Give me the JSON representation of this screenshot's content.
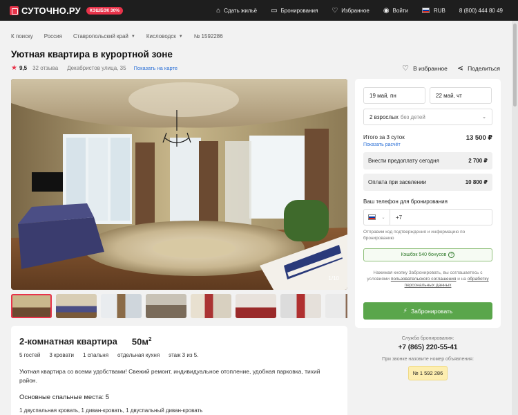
{
  "header": {
    "logo": "СУТОЧНО.РУ",
    "cashback_pill": "КЭШБЭК 30%",
    "nav": [
      {
        "label": "Сдать жильё",
        "icon": "house-plus-icon"
      },
      {
        "label": "Бронирования",
        "icon": "ticket-icon"
      },
      {
        "label": "Избранное",
        "icon": "heart-icon"
      },
      {
        "label": "Войти",
        "icon": "user-icon"
      }
    ],
    "currency": "RUB",
    "phone": "8 (800) 444 80 49"
  },
  "breadcrumb": {
    "back": "К поиску",
    "country": "Россия",
    "region": "Ставропольский край",
    "city": "Кисловодск",
    "listing_id": "№ 1592286"
  },
  "listing": {
    "title": "Уютная квартира в курортной зоне",
    "rating": "9,5",
    "reviews": "32 отзыва",
    "address": "Декабристов улица, 35",
    "map_link": "Показать на карте",
    "favorite": "В избранное",
    "share": "Поделиться",
    "photo_counter": "1/10"
  },
  "description": {
    "rooms": "2-комнатная квартира",
    "area": "50м",
    "area_sup": "2",
    "specs": [
      "5 гостей",
      "3 кровати",
      "1 спальня",
      "отдельная кухня",
      "этаж 3 из 5."
    ],
    "text": "Уютная квартира со всеми удобствами! Свежий ремонт, индивидуальное отопление, удобная парковка, тихий район.",
    "beds_title": "Основные спальные места: 5",
    "beds_list": "1 двуспальная кровать, 1 диван-кровать, 1 двуспальный диван-кровать"
  },
  "booking": {
    "checkin": "19 май, пн",
    "checkout": "22 май, чт",
    "guests": "2 взрослых",
    "guests_muted": "без детей",
    "total_label": "Итого за 3 суток",
    "total": "13 500 ₽",
    "calc_link": "Показать расчёт",
    "prepay_label": "Внести предоплату сегодня",
    "prepay": "2 700 ₽",
    "onsite_label": "Оплата при заселении",
    "onsite": "10 800 ₽",
    "phone_label": "Ваш телефон для бронирования",
    "phone_prefix": "+7",
    "sms_note": "Отправим код подтверждения и информацию по бронированию",
    "cashback": "Кэшбэк 540 бонусов",
    "consent_1": "Нажимая кнопку Забронировать, вы соглашаетесь с условиями ",
    "consent_link1": "пользовательского соглашения",
    "consent_2": " и на ",
    "consent_link2": "обработку персональных данных",
    "button": "Забронировать"
  },
  "service": {
    "label": "Служба бронирования:",
    "phone": "+7 (865) 220-55-41",
    "hint": "При звонке назовите номер объявления:",
    "number": "№ 1 592 286"
  },
  "colors": {
    "brand": "#e8334a",
    "book_button": "#5aa64b",
    "link": "#2a6fd6"
  }
}
